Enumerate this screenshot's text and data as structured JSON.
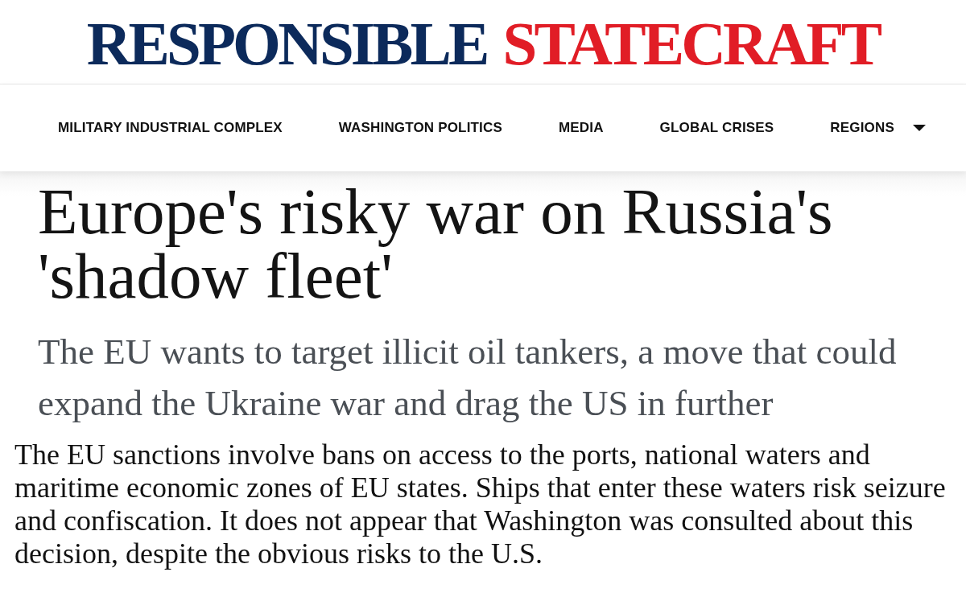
{
  "logo": {
    "parts": [
      {
        "text": "RESPONSIBLE",
        "color": "#0c2a5b"
      },
      {
        "text": "STATECRAFT",
        "color": "#e11d26"
      }
    ]
  },
  "nav": {
    "items": [
      {
        "label": "MILITARY INDUSTRIAL COMPLEX",
        "dropdown": false
      },
      {
        "label": "WASHINGTON POLITICS",
        "dropdown": false
      },
      {
        "label": "MEDIA",
        "dropdown": false
      },
      {
        "label": "GLOBAL CRISES",
        "dropdown": false
      },
      {
        "label": "REGIONS",
        "dropdown": true
      }
    ]
  },
  "article": {
    "headline": "Europe's risky war on Russia's 'shadow fleet'",
    "dek": "The EU wants to target illicit oil tankers, a move that could expand the Ukraine war and drag the US in further",
    "body": "The EU sanctions involve bans on access to the ports, national waters and maritime economic zones of EU states. Ships that enter these waters risk seizure and confiscation. It does not appear that Washington was consulted about this decision, despite the obvious risks to the U.S."
  }
}
